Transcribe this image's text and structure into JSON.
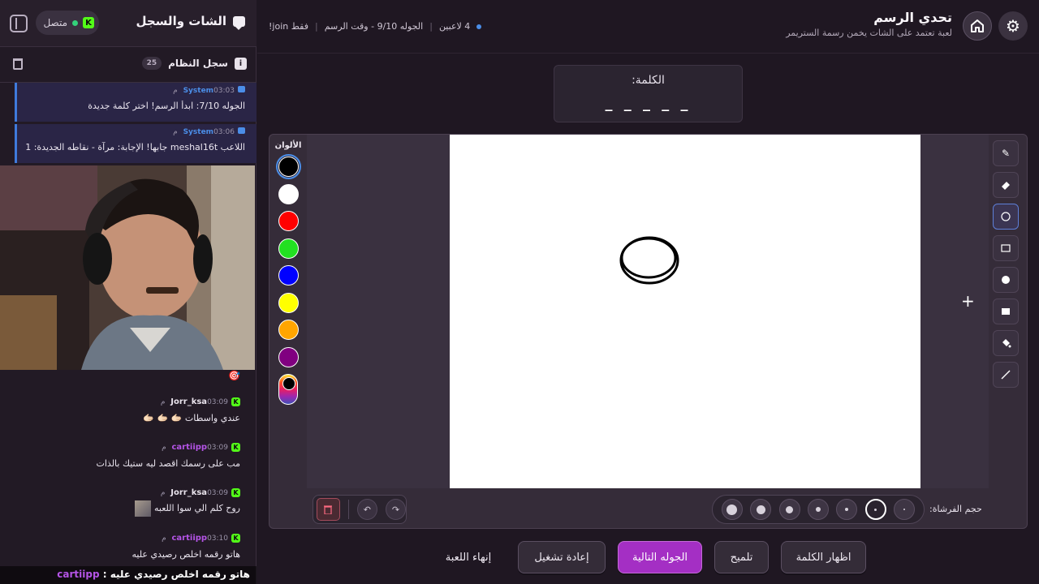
{
  "sidebar": {
    "title": "الشات والسجل",
    "status_label": "متصل",
    "status_badge": "K",
    "log": {
      "title": "سجل النظام",
      "count": "25"
    },
    "system_messages": [
      {
        "sender": "System",
        "time": "03:03 م",
        "text": "الجوله 7/10: ابدأ الرسم! اختر كلمة جديدة"
      },
      {
        "sender": "System",
        "time": "03:06 م",
        "text": "اللاعب meshal16t جابها! الإجابة: مرآة - نقاطه الجديدة: 1"
      }
    ],
    "chat_messages": [
      {
        "user": "Jorr_ksa",
        "time": "03:09 م",
        "text": "عندي واسطات 🫱🏻 🫱🏻 🫱🏻",
        "color": "#e9e3ec"
      },
      {
        "user": "cartiipp",
        "time": "03:09 م",
        "text": "مب على رسمك اقصد ليه ستيك بالذات",
        "color": "#b454e6"
      },
      {
        "user": "Jorr_ksa",
        "time": "03:09 م",
        "text": "روح كلم الي سوا اللعبه",
        "color": "#e9e3ec"
      },
      {
        "user": "cartiipp",
        "time": "03:10 م",
        "text": "هاتو رقمه اخلص رصيدي عليه",
        "color": "#b454e6"
      }
    ],
    "ticker": {
      "user": "cartiipp",
      "text": "هاتو رقمه اخلص رصيدي عليه :"
    }
  },
  "topbar": {
    "title": "تحدي الرسم",
    "subtitle": "لعبة تعتمد على الشات يخمن رسمة الستريمر",
    "players": "4 لاعبين",
    "round": "الجوله 9/10 - وقت الرسم",
    "join_hint": "!join فقط"
  },
  "word": {
    "label": "الكلمة:",
    "blanks": "_ _ _ _ _"
  },
  "colors": {
    "title": "الألوان",
    "swatches": [
      "#000000",
      "#ffffff",
      "#ff0000",
      "#22e021",
      "#0000ff",
      "#ffff00",
      "#ffa500",
      "#800080"
    ]
  },
  "tools": [
    "brush-icon",
    "eraser-icon",
    "circle-outline-icon",
    "rectangle-outline-icon",
    "filled-circle-icon",
    "filled-rectangle-icon",
    "fill-bucket-icon",
    "line-icon"
  ],
  "brush": {
    "label": "حجم الفرشاة:"
  },
  "buttons": {
    "reveal": "اظهار الكلمة",
    "hint": "تلميح",
    "next_round": "الجوله التالية",
    "restart": "إعادة تشغيل",
    "end_game": "إنهاء اللعبة"
  }
}
